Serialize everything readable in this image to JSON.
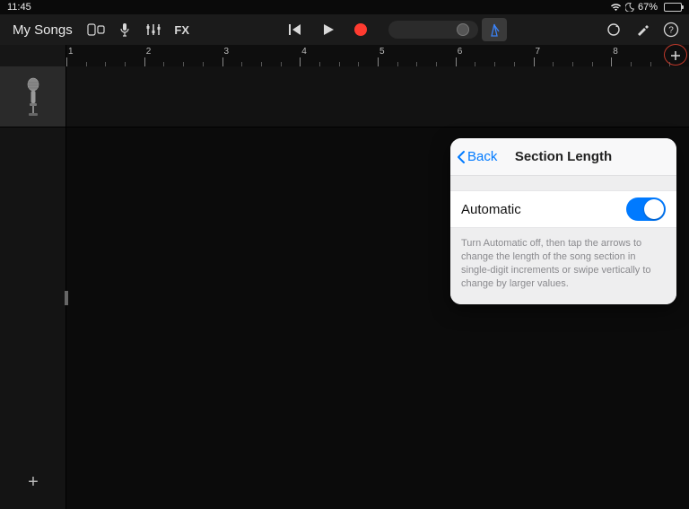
{
  "statusbar": {
    "time": "11:45",
    "battery_text": "67%"
  },
  "toolbar": {
    "my_songs": "My Songs",
    "fx_label": "FX"
  },
  "ruler": {
    "labels": [
      "1",
      "2",
      "3",
      "4",
      "5",
      "6",
      "7",
      "8"
    ]
  },
  "popover": {
    "back_label": "Back",
    "title": "Section Length",
    "automatic_label": "Automatic",
    "description": "Turn Automatic off, then tap the arrows to change the length of the song section in single-digit increments or swipe vertically to change by larger values."
  }
}
